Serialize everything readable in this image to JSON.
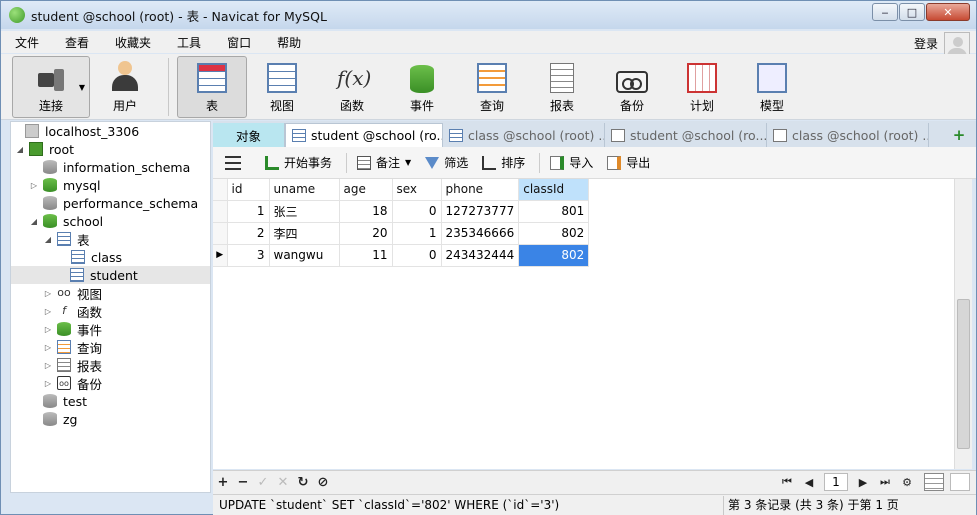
{
  "window": {
    "title": "student @school (root) - 表 - Navicat for MySQL",
    "minimize_glyph": "‒",
    "maximize_glyph": "□",
    "close_glyph": "✕"
  },
  "menu": {
    "items": [
      "文件",
      "查看",
      "收藏夹",
      "工具",
      "窗口",
      "帮助"
    ],
    "login": "登录"
  },
  "toolbar": {
    "connect": "连接",
    "user": "用户",
    "table": "表",
    "view": "视图",
    "function": "函数",
    "event": "事件",
    "query": "查询",
    "report": "报表",
    "backup": "备份",
    "schedule": "计划",
    "model": "模型",
    "fx_glyph": "f(x)"
  },
  "sidebar": {
    "connection": "localhost_3306",
    "root": "root",
    "databases": {
      "information_schema": "information_schema",
      "mysql": "mysql",
      "performance_schema": "performance_schema",
      "school": "school",
      "test": "test",
      "zg": "zg"
    },
    "school_children": {
      "tables": "表",
      "class": "class",
      "student": "student",
      "views": "视图",
      "functions": "函数",
      "events": "事件",
      "queries": "查询",
      "reports": "报表",
      "backups": "备份"
    }
  },
  "tabs": {
    "objects": "对象",
    "t1": "student @school (ro...",
    "t2": "class @school (root) ...",
    "t3": "student @school (ro...",
    "t4": "class @school (root) ..."
  },
  "actions": {
    "begin_transaction": "开始事务",
    "memo": "备注",
    "filter": "筛选",
    "sort": "排序",
    "import": "导入",
    "export": "导出"
  },
  "grid": {
    "columns": [
      "id",
      "uname",
      "age",
      "sex",
      "phone",
      "classId"
    ],
    "rows": [
      [
        "1",
        "张三",
        "18",
        "0",
        "127273777",
        "801"
      ],
      [
        "2",
        "李四",
        "20",
        "1",
        "235346666",
        "802"
      ],
      [
        "3",
        "wangwu",
        "11",
        "0",
        "243432444",
        "802"
      ]
    ],
    "current_row_marker": "▶"
  },
  "bottom": {
    "add": "+",
    "remove": "−",
    "apply": "✓",
    "discard": "✕",
    "refresh": "↻",
    "stop": "⊘",
    "first": "⏮",
    "prev": "◀",
    "page": "1",
    "next": "▶",
    "last": "⏭",
    "settings": "⚙"
  },
  "status": {
    "sql": "UPDATE `student` SET `classId`='802' WHERE (`id`='3')",
    "records": "第 3 条记录 (共 3 条) 于第 1 页"
  },
  "colors": {
    "selected_cell": "#3a84e6",
    "selected_header": "#bfe1fb",
    "objects_tab": "#b9e6f0",
    "db_green": "#4a9b2e"
  }
}
